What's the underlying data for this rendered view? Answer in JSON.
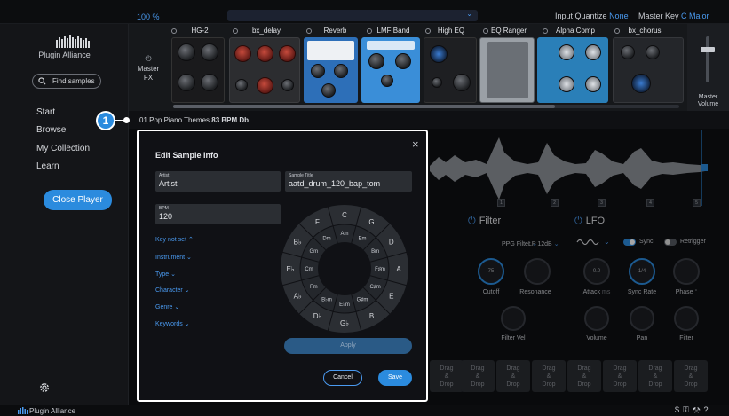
{
  "topbar": {
    "zoom": "100 %",
    "input_quantize_label": "Input Quantize",
    "input_quantize_value": "None",
    "master_key_label": "Master Key",
    "master_key_value": "C Major"
  },
  "sidebar": {
    "brand": "Plugin Alliance",
    "search_placeholder": "Find samples",
    "nav": [
      "Start",
      "Browse",
      "My Collection",
      "Learn"
    ],
    "close_player": "Close Player",
    "footer_brand": "Plugin Alliance"
  },
  "fx": {
    "master_label_1": "Master",
    "master_label_2": "FX",
    "plugins": [
      "HG-2",
      "bx_delay",
      "Reverb",
      "LMF Band",
      "High EQ",
      "EQ Ranger",
      "Alpha Comp",
      "bx_chorus"
    ],
    "master_volume_1": "Master",
    "master_volume_2": "Volume"
  },
  "sample": {
    "badge": "1",
    "name": "01 Pop Piano Themes",
    "bpm": "83 BPM",
    "key": "Db"
  },
  "wave_markers": [
    "1",
    "2",
    "3",
    "4",
    "5",
    "6"
  ],
  "filter": {
    "title": "Filter",
    "type": "PPG Filter",
    "slope": "LP 12dB",
    "cutoff_label": "Cutoff",
    "cutoff_value": "75",
    "resonance_label": "Resonance",
    "filtervel_label": "Filter Vel"
  },
  "lfo": {
    "title": "LFO",
    "sync_label": "Sync",
    "retrigger_label": "Retrigger",
    "attack_label": "Attack",
    "attack_unit": "ms",
    "attack_value": "0.0",
    "syncrate_label": "Sync Rate",
    "syncrate_value": "1/4",
    "phase_label": "Phase",
    "phase_unit": "°",
    "volume_label": "Volume",
    "pan_label": "Pan",
    "filter_label": "Filter"
  },
  "pads": [
    "Drag\n&\nDrop",
    "Drag\n&\nDrop",
    "Drag\n&\nDrop",
    "Drag\n&\nDrop",
    "Drag\n&\nDrop",
    "Drag\n&\nDrop",
    "Drag\n&\nDrop",
    "Drag\n&\nDrop"
  ],
  "modal": {
    "title": "Edit Sample Info",
    "close": "×",
    "artist_label": "Artist",
    "artist_value": "Artist",
    "title_label": "Sample Title",
    "title_value": "aatd_drum_120_bap_tom",
    "bpm_label": "BPM",
    "bpm_value": "120",
    "key_not_set": "Key not set",
    "instrument": "Instrument",
    "type": "Type",
    "character": "Character",
    "genre": "Genre",
    "keywords": "Keywords",
    "apply": "Apply",
    "cancel": "Cancel",
    "save": "Save",
    "outer_keys": [
      "C",
      "G",
      "D",
      "A",
      "E",
      "B",
      "G♭",
      "D♭",
      "A♭",
      "E♭",
      "B♭",
      "F"
    ],
    "inner_keys": [
      "Am",
      "Em",
      "Bm",
      "F♯m",
      "C♯m",
      "G♯m",
      "E♭m",
      "B♭m",
      "Fm",
      "Cm",
      "Gm",
      "Dm"
    ]
  },
  "colors": {
    "accent": "#2b8bde",
    "link": "#4a9af0",
    "background": "#0b0c0e"
  }
}
